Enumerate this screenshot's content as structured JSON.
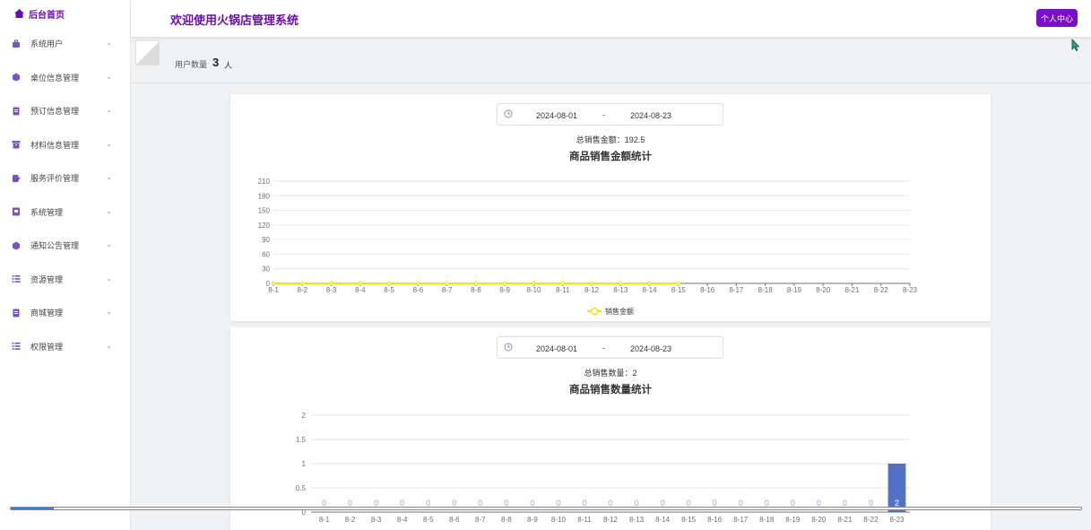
{
  "sidebar": {
    "brand": "后台首页",
    "items": [
      {
        "label": "系统用户",
        "icon": "briefcase-icon"
      },
      {
        "label": "桌位信息管理",
        "icon": "cube-icon"
      },
      {
        "label": "预订信息管理",
        "icon": "document-icon"
      },
      {
        "label": "材料信息管理",
        "icon": "archive-icon"
      },
      {
        "label": "服务评价管理",
        "icon": "edit-icon"
      },
      {
        "label": "系统管理",
        "icon": "file-icon"
      },
      {
        "label": "通知公告管理",
        "icon": "cube-icon"
      },
      {
        "label": "资源管理",
        "icon": "list-icon"
      },
      {
        "label": "商城管理",
        "icon": "document-icon"
      },
      {
        "label": "权限管理",
        "icon": "list-icon"
      }
    ]
  },
  "header": {
    "title": "欢迎使用火锅店管理系统",
    "user_button": "个人中心"
  },
  "user_count": {
    "label": "用户数量",
    "value": "3",
    "unit": "人"
  },
  "sales_amount": {
    "date_start": "2024-08-01",
    "date_sep": "-",
    "date_end": "2024-08-23",
    "total_text": "总销售金额：192.5"
  },
  "sales_count": {
    "date_start": "2024-08-01",
    "date_sep": "-",
    "date_end": "2024-08-23",
    "total_text": "总销售数量：2"
  },
  "colors": {
    "brand": "#6a0dad",
    "button": "#7a0fc9",
    "line_series": "#f2e600",
    "bar_series": "#5470c6"
  },
  "chart_data": [
    {
      "type": "line",
      "title": "商品销售金额统计",
      "categories": [
        "8-1",
        "8-2",
        "8-3",
        "8-4",
        "8-5",
        "8-6",
        "8-7",
        "8-8",
        "8-9",
        "8-10",
        "8-11",
        "8-12",
        "8-13",
        "8-14",
        "8-15",
        "8-16",
        "8-17",
        "8-18",
        "8-19",
        "8-20",
        "8-21",
        "8-22",
        "8-23"
      ],
      "series": [
        {
          "name": "销售金额",
          "values": [
            0,
            0,
            0,
            0,
            0,
            0,
            0,
            0,
            0,
            0,
            0,
            0,
            0,
            0,
            0
          ]
        }
      ],
      "yticks": [
        0,
        30,
        60,
        90,
        120,
        150,
        180,
        210
      ],
      "ylim": [
        0,
        210
      ],
      "legend": "bottom-center",
      "grid": true
    },
    {
      "type": "bar",
      "title": "商品销售数量统计",
      "categories": [
        "8-1",
        "8-2",
        "8-3",
        "8-4",
        "8-5",
        "8-6",
        "8-7",
        "8-8",
        "8-9",
        "8-10",
        "8-11",
        "8-12",
        "8-13",
        "8-14",
        "8-15",
        "8-16",
        "8-17",
        "8-18",
        "8-19",
        "8-20",
        "8-21",
        "8-22",
        "8-23"
      ],
      "values": [
        0,
        0,
        0,
        0,
        0,
        0,
        0,
        0,
        0,
        0,
        0,
        0,
        0,
        0,
        0,
        0,
        0,
        0,
        0,
        0,
        0,
        0,
        1
      ],
      "data_labels": [
        "0",
        "0",
        "0",
        "0",
        "0",
        "0",
        "0",
        "0",
        "0",
        "0",
        "0",
        "0",
        "0",
        "0",
        "0",
        "0",
        "0",
        "0",
        "0",
        "0",
        "0",
        "0",
        "2"
      ],
      "yticks": [
        "0",
        "0.5",
        "1",
        "1.5",
        "2"
      ],
      "ylim": [
        0,
        2
      ],
      "grid": true
    }
  ]
}
